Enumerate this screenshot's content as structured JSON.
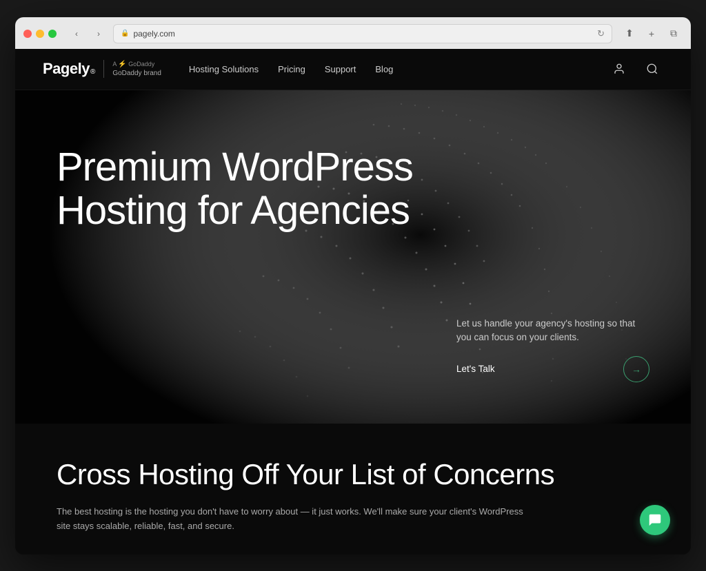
{
  "browser": {
    "url": "pagely.com",
    "url_full": "pagely.com",
    "reload_label": "↻",
    "back_label": "‹",
    "forward_label": "›"
  },
  "nav": {
    "logo": "Pagely",
    "logo_trademark": "®",
    "godaddy_a": "A",
    "godaddy_brand": "GoDaddy brand",
    "links": [
      {
        "label": "Hosting Solutions",
        "href": "#"
      },
      {
        "label": "Pricing",
        "href": "#"
      },
      {
        "label": "Support",
        "href": "#"
      },
      {
        "label": "Blog",
        "href": "#"
      }
    ]
  },
  "hero": {
    "title": "Premium WordPress Hosting for Agencies",
    "subtitle": "Let us handle your agency's hosting so that you can focus on your clients.",
    "cta_label": "Let's Talk",
    "cta_arrow": "→"
  },
  "section_two": {
    "title": "Cross Hosting Off Your List of Concerns",
    "subtitle": "The best hosting is the hosting you don't have to worry about — it just works. We'll make sure your client's WordPress site stays scalable, reliable, fast, and secure."
  },
  "chat": {
    "icon": "💬"
  }
}
